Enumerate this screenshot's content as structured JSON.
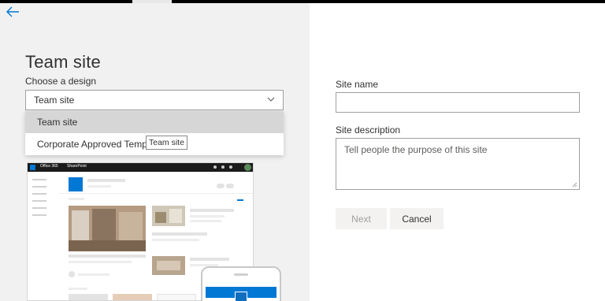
{
  "header": {
    "title": "Team site",
    "back_icon": "back-arrow-icon"
  },
  "design": {
    "label": "Choose a design",
    "selected": "Team site",
    "options": [
      "Team site",
      "Corporate Approved Temp"
    ],
    "tooltip": "Team site"
  },
  "preview": {
    "suite_label": "Office 365",
    "app_label": "SharePoint"
  },
  "form": {
    "site_name_label": "Site name",
    "site_name_value": "",
    "site_description_label": "Site description",
    "site_description_placeholder": "Tell people the purpose of this site",
    "next_label": "Next",
    "cancel_label": "Cancel"
  },
  "colors": {
    "accent": "#0078d4",
    "left_panel": "#f1f1f1",
    "selected_option": "#d6d6d6"
  }
}
